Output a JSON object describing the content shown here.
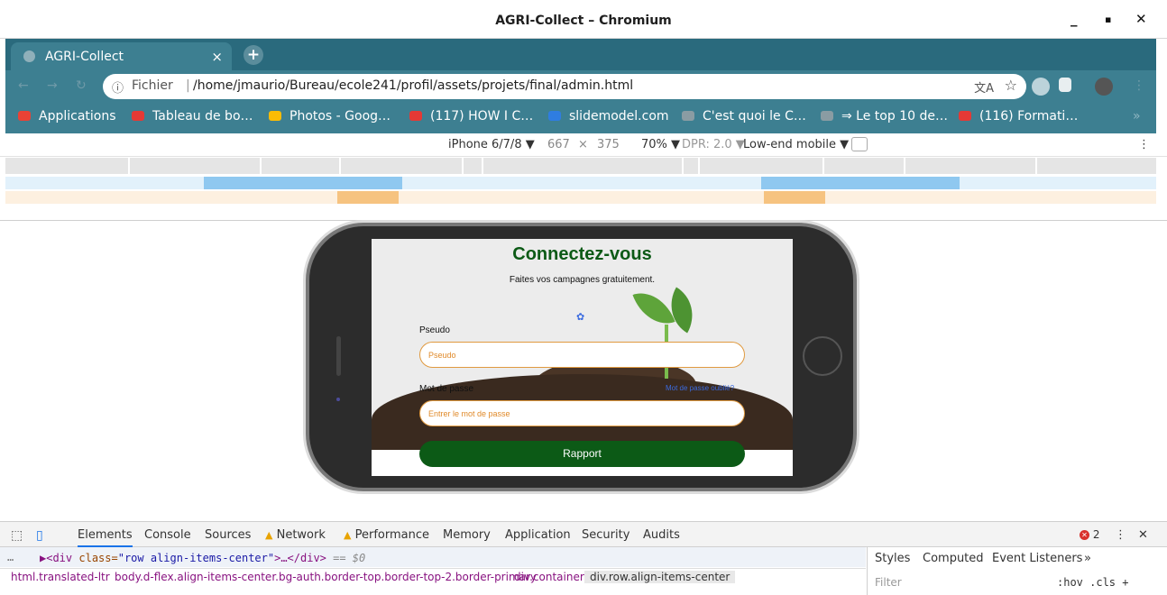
{
  "window": {
    "title": "AGRI-Collect – Chromium",
    "min": "_",
    "max": "▪",
    "close": "✕"
  },
  "tab": {
    "label": "AGRI-Collect",
    "close": "×",
    "new": "+"
  },
  "omnibox": {
    "info_icon": "ⓘ",
    "scheme": "Fichier",
    "separator": "|",
    "url": "/home/jmaurio/Bureau/ecole241/profil/assets/projets/final/admin.html",
    "translate_icon": "translate-icon",
    "star": "☆"
  },
  "bookmarks": [
    {
      "label": "Applications",
      "color": "#e94235"
    },
    {
      "label": "Tableau de bo…",
      "color": "#e53935"
    },
    {
      "label": "Photos - Goog…",
      "color": "#fbbc04"
    },
    {
      "label": "(117) HOW I C…",
      "color": "#e53935"
    },
    {
      "label": "slidemodel.com",
      "color": "#2f7de1"
    },
    {
      "label": "C'est quoi le C…",
      "color": "#8a9ca3"
    },
    {
      "label": "⇒ Le top 10 de…",
      "color": "#8a9ca3"
    },
    {
      "label": "(116) Formati…",
      "color": "#e53935"
    }
  ],
  "bookmarks_more": "»",
  "device": {
    "name": "iPhone 6/7/8 ▼",
    "width": "667",
    "times": "×",
    "height": "375",
    "zoom": "70% ▼",
    "dpr": "DPR: 2.0 ▼",
    "throttle": "Low-end mobile ▼",
    "rotate_icon": "⃠",
    "menu": "⋮"
  },
  "login": {
    "title": "Connectez-vous",
    "subtitle": "Faites vos campagnes gratuitement.",
    "spinner": "✿",
    "pseudo_label": "Pseudo",
    "pseudo_placeholder": "Pseudo",
    "pass_label": "Mot de passe",
    "forgot": "Mot de passe oublié?",
    "pass_placeholder": "Entrer le mot de passe",
    "submit": "Rapport"
  },
  "devtools": {
    "tabs": [
      "Elements",
      "Console",
      "Sources",
      "Network",
      "Performance",
      "Memory",
      "Application",
      "Security",
      "Audits"
    ],
    "error_count": "2",
    "menu": "⋮",
    "close": "✕",
    "ellipsis": "…",
    "code": {
      "lead": "▶<",
      "tag": "div",
      "attr": " class=",
      "val": "\"row align-items-center\"",
      "tail": ">…</div>",
      "eq": " == $0"
    },
    "crumbs": [
      "html.translated-ltr",
      "body.d-flex.align-items-center.bg-auth.border-top.border-top-2.border-primary",
      "div.container",
      "div.row.align-items-center"
    ],
    "styles_tabs": [
      "Styles",
      "Computed",
      "Event Listeners",
      "»"
    ],
    "filter": "Filter",
    "hov": ":hov  .cls  +"
  }
}
